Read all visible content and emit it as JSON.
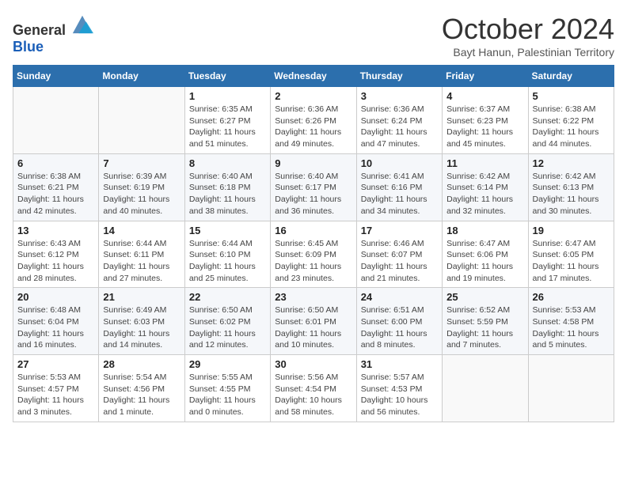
{
  "header": {
    "logo_general": "General",
    "logo_blue": "Blue",
    "month": "October 2024",
    "location": "Bayt Hanun, Palestinian Territory"
  },
  "weekdays": [
    "Sunday",
    "Monday",
    "Tuesday",
    "Wednesday",
    "Thursday",
    "Friday",
    "Saturday"
  ],
  "weeks": [
    [
      {
        "day": "",
        "info": ""
      },
      {
        "day": "",
        "info": ""
      },
      {
        "day": "1",
        "info": "Sunrise: 6:35 AM\nSunset: 6:27 PM\nDaylight: 11 hours and 51 minutes."
      },
      {
        "day": "2",
        "info": "Sunrise: 6:36 AM\nSunset: 6:26 PM\nDaylight: 11 hours and 49 minutes."
      },
      {
        "day": "3",
        "info": "Sunrise: 6:36 AM\nSunset: 6:24 PM\nDaylight: 11 hours and 47 minutes."
      },
      {
        "day": "4",
        "info": "Sunrise: 6:37 AM\nSunset: 6:23 PM\nDaylight: 11 hours and 45 minutes."
      },
      {
        "day": "5",
        "info": "Sunrise: 6:38 AM\nSunset: 6:22 PM\nDaylight: 11 hours and 44 minutes."
      }
    ],
    [
      {
        "day": "6",
        "info": "Sunrise: 6:38 AM\nSunset: 6:21 PM\nDaylight: 11 hours and 42 minutes."
      },
      {
        "day": "7",
        "info": "Sunrise: 6:39 AM\nSunset: 6:19 PM\nDaylight: 11 hours and 40 minutes."
      },
      {
        "day": "8",
        "info": "Sunrise: 6:40 AM\nSunset: 6:18 PM\nDaylight: 11 hours and 38 minutes."
      },
      {
        "day": "9",
        "info": "Sunrise: 6:40 AM\nSunset: 6:17 PM\nDaylight: 11 hours and 36 minutes."
      },
      {
        "day": "10",
        "info": "Sunrise: 6:41 AM\nSunset: 6:16 PM\nDaylight: 11 hours and 34 minutes."
      },
      {
        "day": "11",
        "info": "Sunrise: 6:42 AM\nSunset: 6:14 PM\nDaylight: 11 hours and 32 minutes."
      },
      {
        "day": "12",
        "info": "Sunrise: 6:42 AM\nSunset: 6:13 PM\nDaylight: 11 hours and 30 minutes."
      }
    ],
    [
      {
        "day": "13",
        "info": "Sunrise: 6:43 AM\nSunset: 6:12 PM\nDaylight: 11 hours and 28 minutes."
      },
      {
        "day": "14",
        "info": "Sunrise: 6:44 AM\nSunset: 6:11 PM\nDaylight: 11 hours and 27 minutes."
      },
      {
        "day": "15",
        "info": "Sunrise: 6:44 AM\nSunset: 6:10 PM\nDaylight: 11 hours and 25 minutes."
      },
      {
        "day": "16",
        "info": "Sunrise: 6:45 AM\nSunset: 6:09 PM\nDaylight: 11 hours and 23 minutes."
      },
      {
        "day": "17",
        "info": "Sunrise: 6:46 AM\nSunset: 6:07 PM\nDaylight: 11 hours and 21 minutes."
      },
      {
        "day": "18",
        "info": "Sunrise: 6:47 AM\nSunset: 6:06 PM\nDaylight: 11 hours and 19 minutes."
      },
      {
        "day": "19",
        "info": "Sunrise: 6:47 AM\nSunset: 6:05 PM\nDaylight: 11 hours and 17 minutes."
      }
    ],
    [
      {
        "day": "20",
        "info": "Sunrise: 6:48 AM\nSunset: 6:04 PM\nDaylight: 11 hours and 16 minutes."
      },
      {
        "day": "21",
        "info": "Sunrise: 6:49 AM\nSunset: 6:03 PM\nDaylight: 11 hours and 14 minutes."
      },
      {
        "day": "22",
        "info": "Sunrise: 6:50 AM\nSunset: 6:02 PM\nDaylight: 11 hours and 12 minutes."
      },
      {
        "day": "23",
        "info": "Sunrise: 6:50 AM\nSunset: 6:01 PM\nDaylight: 11 hours and 10 minutes."
      },
      {
        "day": "24",
        "info": "Sunrise: 6:51 AM\nSunset: 6:00 PM\nDaylight: 11 hours and 8 minutes."
      },
      {
        "day": "25",
        "info": "Sunrise: 6:52 AM\nSunset: 5:59 PM\nDaylight: 11 hours and 7 minutes."
      },
      {
        "day": "26",
        "info": "Sunrise: 5:53 AM\nSunset: 4:58 PM\nDaylight: 11 hours and 5 minutes."
      }
    ],
    [
      {
        "day": "27",
        "info": "Sunrise: 5:53 AM\nSunset: 4:57 PM\nDaylight: 11 hours and 3 minutes."
      },
      {
        "day": "28",
        "info": "Sunrise: 5:54 AM\nSunset: 4:56 PM\nDaylight: 11 hours and 1 minute."
      },
      {
        "day": "29",
        "info": "Sunrise: 5:55 AM\nSunset: 4:55 PM\nDaylight: 11 hours and 0 minutes."
      },
      {
        "day": "30",
        "info": "Sunrise: 5:56 AM\nSunset: 4:54 PM\nDaylight: 10 hours and 58 minutes."
      },
      {
        "day": "31",
        "info": "Sunrise: 5:57 AM\nSunset: 4:53 PM\nDaylight: 10 hours and 56 minutes."
      },
      {
        "day": "",
        "info": ""
      },
      {
        "day": "",
        "info": ""
      }
    ]
  ]
}
